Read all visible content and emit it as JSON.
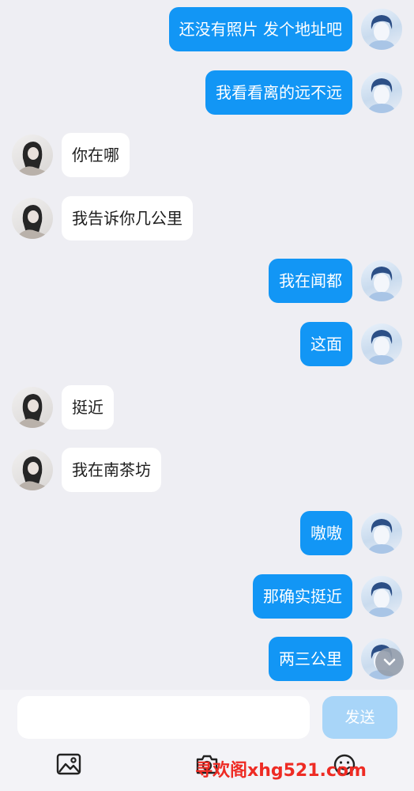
{
  "chat": {
    "messages": [
      {
        "direction": "out",
        "text": "还没有照片 发个地址吧"
      },
      {
        "direction": "out",
        "text": "我看看离的远不远"
      },
      {
        "direction": "in",
        "text": "你在哪"
      },
      {
        "direction": "in",
        "text": "我告诉你几公里"
      },
      {
        "direction": "out",
        "text": "我在闻都"
      },
      {
        "direction": "out",
        "text": "这面"
      },
      {
        "direction": "in",
        "text": "挺近"
      },
      {
        "direction": "in",
        "text": "我在南茶坊"
      },
      {
        "direction": "out",
        "text": "嗷嗷"
      },
      {
        "direction": "out",
        "text": "那确实挺近"
      },
      {
        "direction": "out",
        "text": "两三公里"
      }
    ]
  },
  "composer": {
    "input_value": "",
    "send_label": "发送"
  },
  "toolbar": {
    "icons": [
      "image-icon",
      "camera-icon",
      "emoji-icon"
    ]
  },
  "watermark": {
    "text": "寻欢阁xhg521.com"
  },
  "colors": {
    "outgoing_bubble": "#1296f5",
    "incoming_bubble": "#ffffff",
    "background": "#eeeef3",
    "send_button_disabled": "#a8d5f8",
    "watermark": "#ee2b24"
  }
}
